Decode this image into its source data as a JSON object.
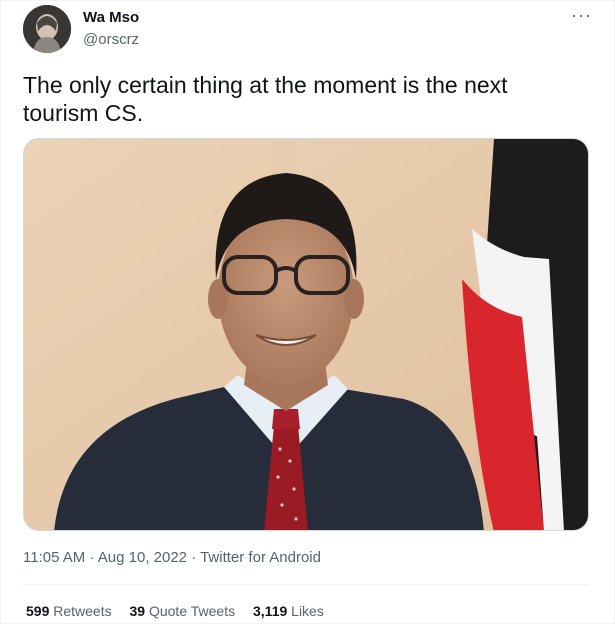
{
  "author": {
    "display_name": "Wa Mso",
    "handle": "@orscrz"
  },
  "more_icon": "more-horizontal-icon",
  "tweet": {
    "text": "The only certain thing at the moment is the next tourism CS."
  },
  "meta": {
    "time": "11:05 AM",
    "separator": " · ",
    "date": "Aug 10, 2022",
    "source": "Twitter for Android"
  },
  "stats": {
    "retweets_count": "599",
    "retweets_label": "Retweets",
    "quotes_count": "39",
    "quotes_label": "Quote Tweets",
    "likes_count": "3,119",
    "likes_label": "Likes"
  },
  "colors": {
    "text_primary": "#0f1419",
    "text_secondary": "#536471",
    "border": "#eff3f4",
    "flag_black": "#1c1c1c",
    "flag_red": "#d8262c",
    "flag_white": "#f4f4f4"
  }
}
